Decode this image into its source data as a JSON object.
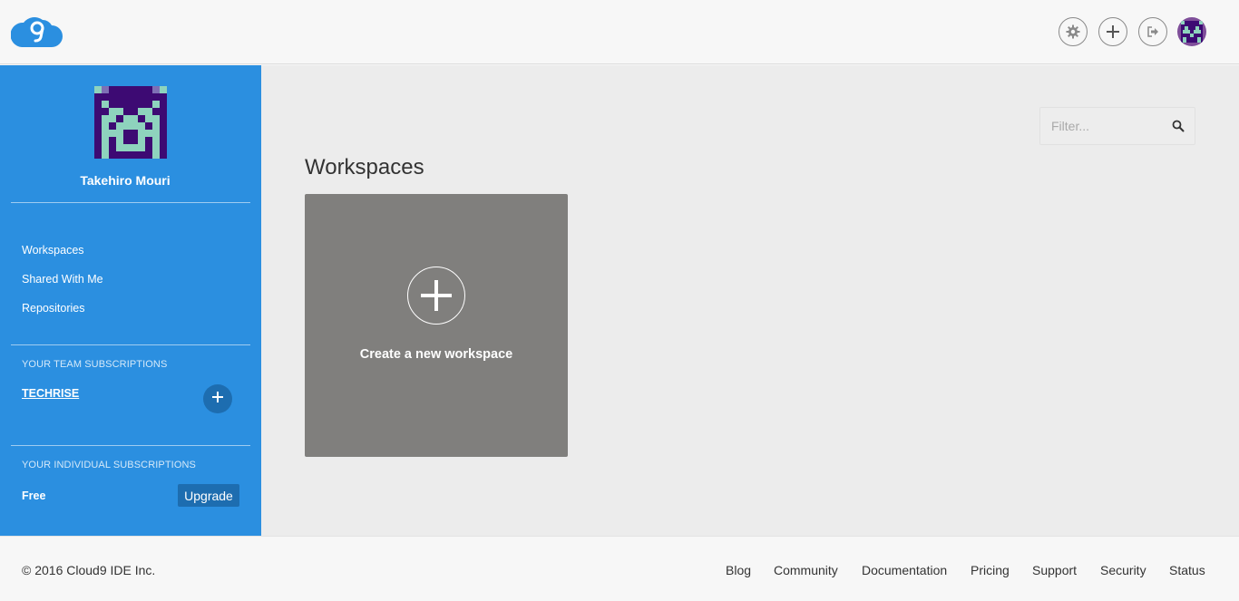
{
  "header": {
    "logo_icon": "cloud9-logo-icon",
    "actions": [
      {
        "icon": "gear-icon",
        "label": "Settings"
      },
      {
        "icon": "plus-icon",
        "label": "New"
      },
      {
        "icon": "logout-icon",
        "label": "Log out"
      }
    ],
    "avatar": "user-avatar"
  },
  "sidebar": {
    "user_name": "Takehiro Mouri",
    "nav": [
      {
        "label": "Workspaces"
      },
      {
        "label": "Shared With Me"
      },
      {
        "label": "Repositories"
      }
    ],
    "team_section_title": "YOUR TEAM SUBSCRIPTIONS",
    "team_name": "TECHRISE",
    "individual_section_title": "YOUR INDIVIDUAL SUBSCRIPTIONS",
    "plan": "Free",
    "upgrade_label": "Upgrade"
  },
  "main": {
    "filter_placeholder": "Filter...",
    "title": "Workspaces",
    "create_label": "Create a new workspace"
  },
  "footer": {
    "copyright": "© 2016 Cloud9 IDE Inc.",
    "links": [
      {
        "label": "Blog"
      },
      {
        "label": "Community"
      },
      {
        "label": "Documentation"
      },
      {
        "label": "Pricing"
      },
      {
        "label": "Support"
      },
      {
        "label": "Security"
      },
      {
        "label": "Status"
      }
    ]
  },
  "colors": {
    "sidebar_bg": "#2b8fe0",
    "sidebar_button": "#1d6db0",
    "card_bg": "#807f7d",
    "avatar_dark": "#3d0a73",
    "avatar_light": "#8ed3bd"
  }
}
